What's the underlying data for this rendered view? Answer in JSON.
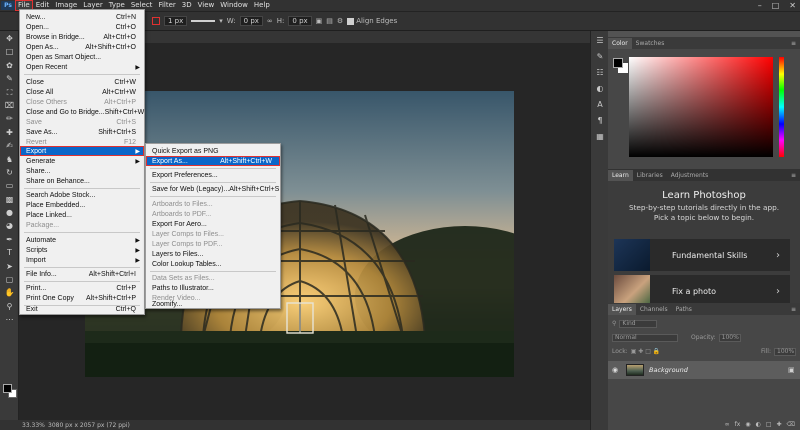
{
  "app": {
    "logo": "Ps"
  },
  "menubar": [
    "File",
    "Edit",
    "Image",
    "Layer",
    "Type",
    "Select",
    "Filter",
    "3D",
    "View",
    "Window",
    "Help"
  ],
  "options": {
    "stroke_width": "1 px",
    "w_label": "W:",
    "w_value": "0 px",
    "h_label": "H:",
    "h_value": "0 px",
    "align_edges": "Align Edges"
  },
  "file_menu": [
    {
      "label": "New...",
      "shortcut": "Ctrl+N"
    },
    {
      "label": "Open...",
      "shortcut": "Ctrl+O"
    },
    {
      "label": "Browse in Bridge...",
      "shortcut": "Alt+Ctrl+O"
    },
    {
      "label": "Open As...",
      "shortcut": "Alt+Shift+Ctrl+O"
    },
    {
      "label": "Open as Smart Object...",
      "shortcut": ""
    },
    {
      "label": "Open Recent",
      "shortcut": ""
    },
    {
      "label": "Close",
      "shortcut": "Ctrl+W"
    },
    {
      "label": "Close All",
      "shortcut": "Alt+Ctrl+W"
    },
    {
      "label": "Close Others",
      "shortcut": "Alt+Ctrl+P"
    },
    {
      "label": "Close and Go to Bridge...",
      "shortcut": "Shift+Ctrl+W"
    },
    {
      "label": "Save",
      "shortcut": "Ctrl+S"
    },
    {
      "label": "Save As...",
      "shortcut": "Shift+Ctrl+S"
    },
    {
      "label": "Revert",
      "shortcut": "F12"
    },
    {
      "label": "Export",
      "shortcut": ""
    },
    {
      "label": "Generate",
      "shortcut": ""
    },
    {
      "label": "Share...",
      "shortcut": ""
    },
    {
      "label": "Share on Behance...",
      "shortcut": ""
    },
    {
      "label": "Search Adobe Stock...",
      "shortcut": ""
    },
    {
      "label": "Place Embedded...",
      "shortcut": ""
    },
    {
      "label": "Place Linked...",
      "shortcut": ""
    },
    {
      "label": "Package...",
      "shortcut": ""
    },
    {
      "label": "Automate",
      "shortcut": ""
    },
    {
      "label": "Scripts",
      "shortcut": ""
    },
    {
      "label": "Import",
      "shortcut": ""
    },
    {
      "label": "File Info...",
      "shortcut": "Alt+Shift+Ctrl+I"
    },
    {
      "label": "Print...",
      "shortcut": "Ctrl+P"
    },
    {
      "label": "Print One Copy",
      "shortcut": "Alt+Shift+Ctrl+P"
    },
    {
      "label": "Exit",
      "shortcut": "Ctrl+Q"
    }
  ],
  "export_menu": [
    {
      "label": "Quick Export as PNG",
      "shortcut": ""
    },
    {
      "label": "Export As...",
      "shortcut": "Alt+Shift+Ctrl+W"
    },
    {
      "label": "Export Preferences...",
      "shortcut": ""
    },
    {
      "label": "Save for Web (Legacy)...",
      "shortcut": "Alt+Shift+Ctrl+S"
    },
    {
      "label": "Artboards to Files...",
      "shortcut": ""
    },
    {
      "label": "Artboards to PDF...",
      "shortcut": ""
    },
    {
      "label": "Export For Aero...",
      "shortcut": ""
    },
    {
      "label": "Layer Comps to Files...",
      "shortcut": ""
    },
    {
      "label": "Layer Comps to PDF...",
      "shortcut": ""
    },
    {
      "label": "Layers to Files...",
      "shortcut": ""
    },
    {
      "label": "Color Lookup Tables...",
      "shortcut": ""
    },
    {
      "label": "Data Sets as Files...",
      "shortcut": ""
    },
    {
      "label": "Paths to Illustrator...",
      "shortcut": ""
    },
    {
      "label": "Render Video...",
      "shortcut": ""
    },
    {
      "label": "Zoomify...",
      "shortcut": ""
    }
  ],
  "status": {
    "zoom": "33.33%",
    "doc_info": "3080 px x 2057 px (72 ppi)"
  },
  "color_panel": {
    "tabs": [
      "Color",
      "Swatches"
    ]
  },
  "learn_panel": {
    "tabs": [
      "Learn",
      "Libraries",
      "Adjustments"
    ],
    "title": "Learn Photoshop",
    "description": "Step-by-step tutorials directly in the app. Pick a topic below to begin.",
    "cards": [
      "Fundamental Skills",
      "Fix a photo"
    ]
  },
  "layers_panel": {
    "tabs": [
      "Layers",
      "Channels",
      "Paths"
    ],
    "filter_kind": "Kind",
    "blend_mode": "Normal",
    "opacity_label": "Opacity:",
    "opacity_value": "100%",
    "lock_label": "Lock:",
    "fill_label": "Fill:",
    "fill_value": "100%",
    "layer_name": "Background"
  },
  "colors": {
    "highlight": "#0a66c9",
    "annotation_red": "#e03131"
  }
}
